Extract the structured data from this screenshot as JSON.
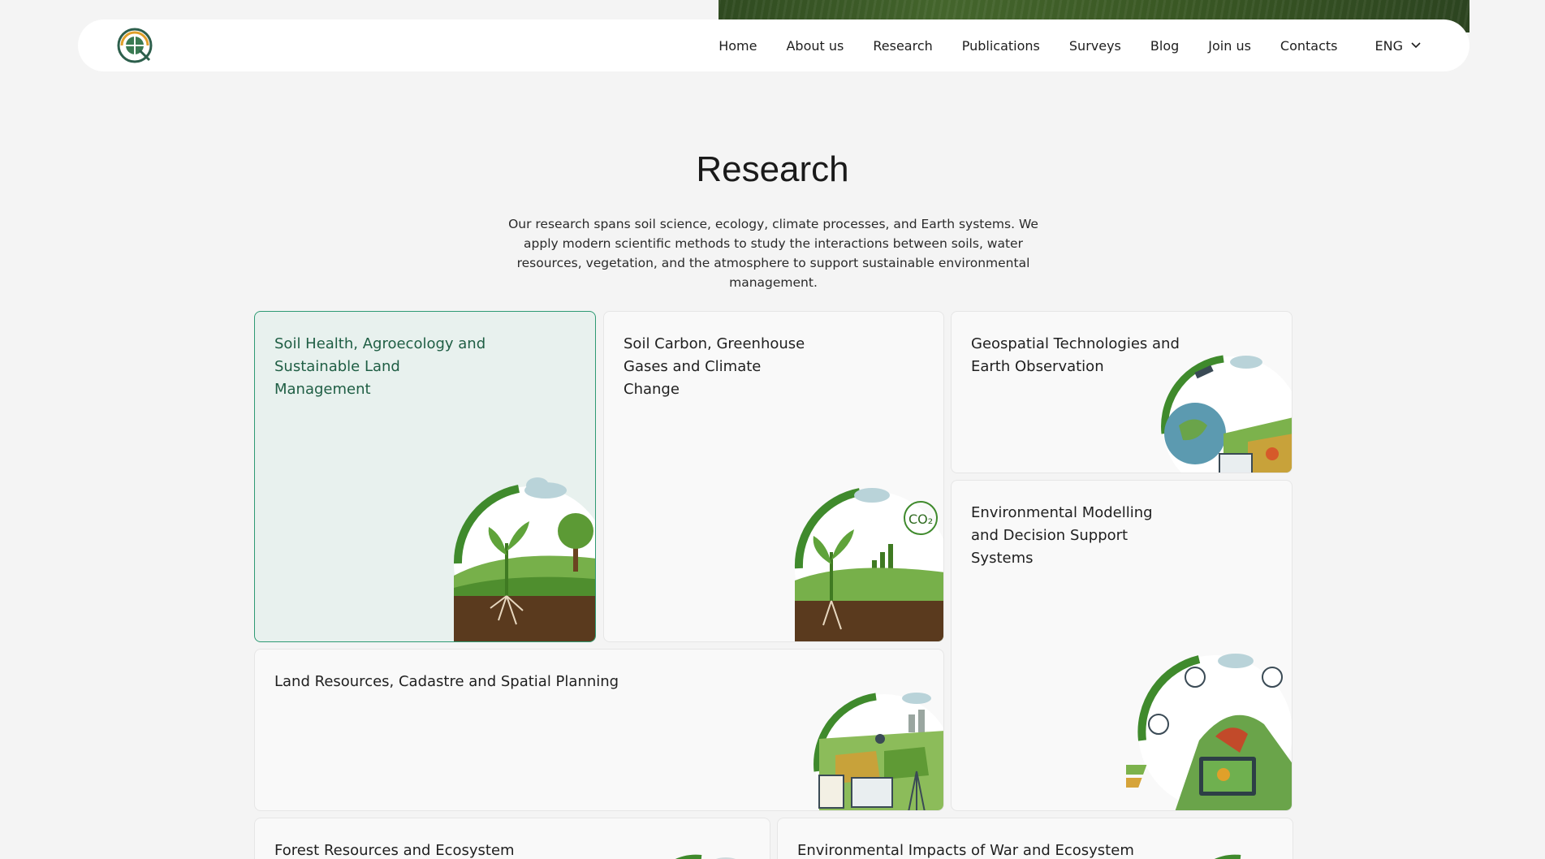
{
  "nav": {
    "links": [
      "Home",
      "About us",
      "Research",
      "Publications",
      "Surveys",
      "Blog",
      "Join us",
      "Contacts"
    ],
    "language": "ENG"
  },
  "page": {
    "title": "Research",
    "intro": "Our research spans soil science, ecology, climate processes, and Earth systems. We apply modern scientific methods to study the interactions between soils, water resources, vegetation, and the atmosphere to support sustainable environmental management."
  },
  "cards": [
    {
      "title": "Soil Health, Agroecology and Sustainable Land Management",
      "icon": "soil-health-illustration-icon"
    },
    {
      "title": "Soil Carbon, Greenhouse Gases and Climate Change",
      "icon": "soil-carbon-illustration-icon",
      "icon_text": "CO₂"
    },
    {
      "title": "Geospatial Technologies and Earth Observation",
      "icon": "geospatial-illustration-icon"
    },
    {
      "title": "Environmental Modelling and Decision Support Systems",
      "icon": "modelling-illustration-icon"
    },
    {
      "title": "Land Resources, Cadastre and Spatial Planning",
      "icon": "land-resources-illustration-icon"
    },
    {
      "title": "Forest Resources and Ecosystem",
      "icon": "forest-illustration-icon"
    },
    {
      "title": "Environmental Impacts of War and Ecosystem",
      "icon": "war-impacts-illustration-icon"
    }
  ],
  "colors": {
    "accent": "#2e9a73",
    "active_card_bg": "#e8f1ee",
    "leaf_green": "#3f8a2c",
    "soil_brown": "#5a3a1e"
  }
}
